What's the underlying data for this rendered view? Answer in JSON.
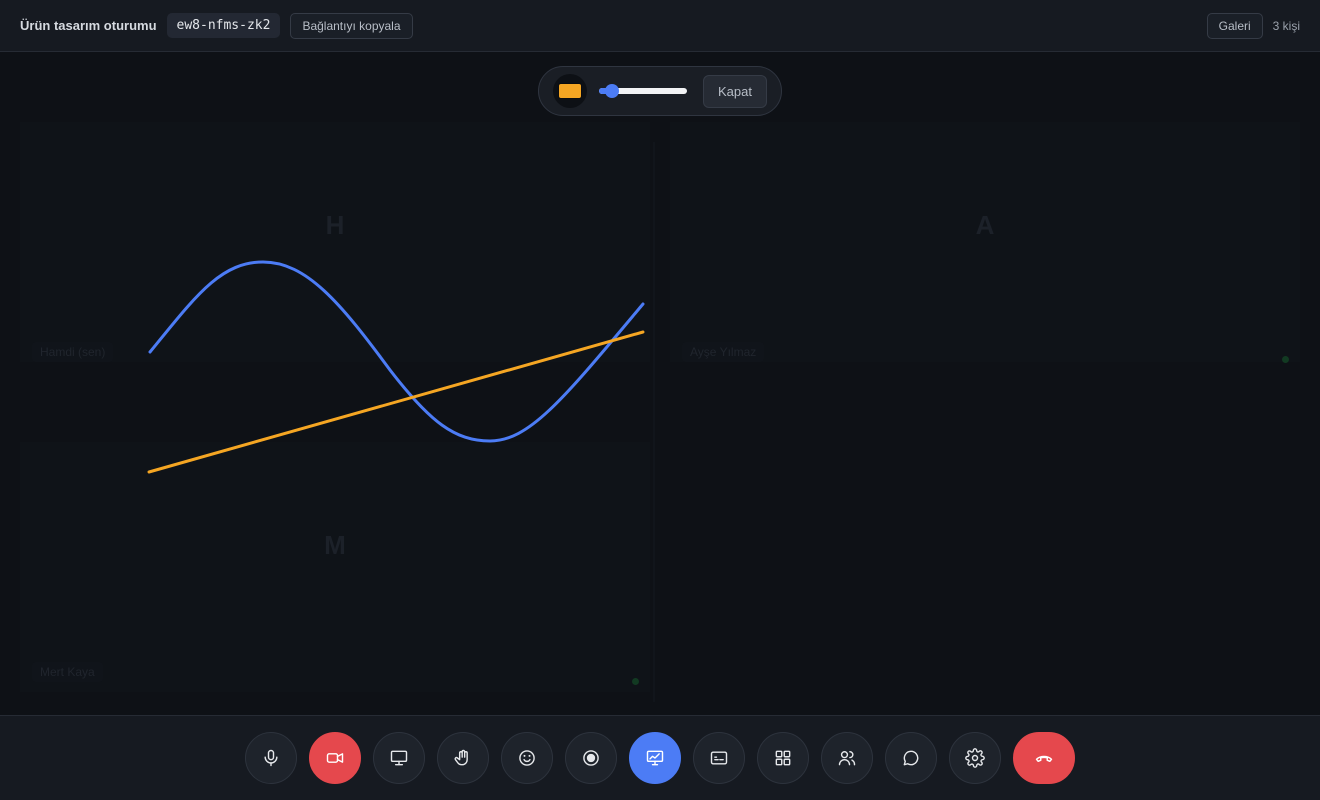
{
  "header": {
    "title": "Ürün tasarım oturumu",
    "meeting_code": "ew8-nfms-zk2",
    "copy_link_label": "Bağlantıyı kopyala",
    "layout_label": "Galeri",
    "participant_count": "3 kişi"
  },
  "annotation_toolbar": {
    "pen_color": "#f5a623",
    "stroke_width_level": 0.15,
    "close_label": "Kapat"
  },
  "participants": [
    {
      "initial": "H",
      "name": "Hamdi (sen)"
    },
    {
      "initial": "A",
      "name": "Ayşe Yılmaz"
    },
    {
      "initial": "M",
      "name": "Mert Kaya"
    }
  ],
  "drawing": {
    "strokes": [
      {
        "color": "#4c7cf5",
        "icon": "wave-stroke"
      },
      {
        "color": "#f5a623",
        "icon": "line-stroke"
      }
    ]
  },
  "controls": [
    {
      "name": "microphone-icon",
      "state": "normal"
    },
    {
      "name": "camera-off-icon",
      "state": "danger"
    },
    {
      "name": "screen-share-icon",
      "state": "normal"
    },
    {
      "name": "raise-hand-icon",
      "state": "normal"
    },
    {
      "name": "emoji-icon",
      "state": "normal"
    },
    {
      "name": "record-icon",
      "state": "normal"
    },
    {
      "name": "whiteboard-icon",
      "state": "active"
    },
    {
      "name": "captions-icon",
      "state": "normal"
    },
    {
      "name": "grid-layout-icon",
      "state": "normal"
    },
    {
      "name": "participants-icon",
      "state": "normal"
    },
    {
      "name": "chat-icon",
      "state": "normal"
    },
    {
      "name": "settings-icon",
      "state": "normal"
    },
    {
      "name": "hang-up-icon",
      "state": "end"
    }
  ],
  "colors": {
    "accent": "#4c7cf5",
    "danger": "#e5484d",
    "speaking": "#123a22"
  }
}
